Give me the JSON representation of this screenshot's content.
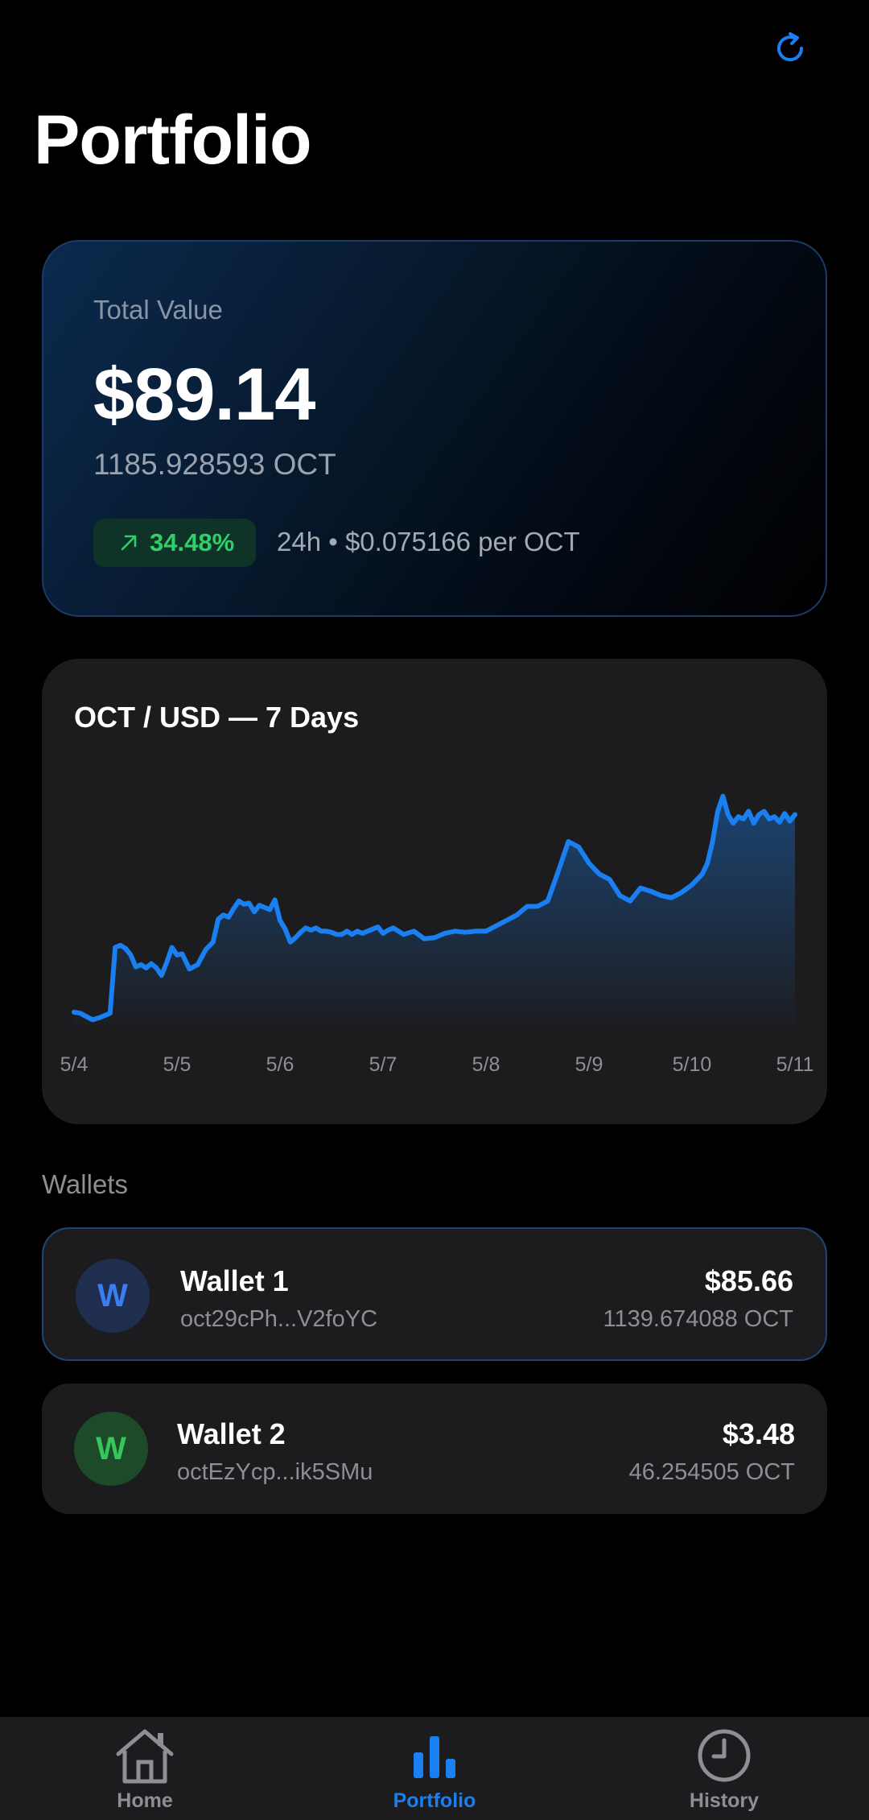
{
  "header": {
    "title": "Portfolio"
  },
  "total": {
    "label": "Total Value",
    "value": "$89.14",
    "oct": "1185.928593 OCT",
    "change_pct": "34.48%",
    "price_info": "24h • $0.075166 per OCT"
  },
  "colors": {
    "accent": "#1a7ff0",
    "positive": "#2fd06a",
    "card": "#1c1c1e"
  },
  "chart_data": {
    "type": "area",
    "title": "OCT / USD — 7 Days",
    "categories": [
      "5/4",
      "5/5",
      "5/6",
      "5/7",
      "5/8",
      "5/9",
      "5/10",
      "5/11"
    ],
    "x": [
      0,
      0.06,
      0.12,
      0.18,
      0.25,
      0.3,
      0.35,
      0.4,
      0.45,
      0.5,
      0.55,
      0.6,
      0.65,
      0.7,
      0.75,
      0.8,
      0.85,
      0.9,
      0.95,
      1.0,
      1.05,
      1.12,
      1.2,
      1.28,
      1.35,
      1.4,
      1.45,
      1.5,
      1.55,
      1.6,
      1.65,
      1.7,
      1.75,
      1.8,
      1.85,
      1.9,
      1.95,
      2.0,
      2.05,
      2.1,
      2.15,
      2.2,
      2.25,
      2.3,
      2.35,
      2.4,
      2.45,
      2.5,
      2.55,
      2.6,
      2.65,
      2.7,
      2.75,
      2.8,
      2.85,
      2.9,
      2.95,
      3.0,
      3.05,
      3.1,
      3.15,
      3.2,
      3.3,
      3.4,
      3.5,
      3.6,
      3.7,
      3.8,
      3.9,
      4.0,
      4.1,
      4.2,
      4.3,
      4.4,
      4.5,
      4.6,
      4.7,
      4.8,
      4.9,
      5.0,
      5.1,
      5.2,
      5.3,
      5.4,
      5.5,
      5.6,
      5.7,
      5.8,
      5.9,
      6.0,
      6.05,
      6.1,
      6.15,
      6.2,
      6.25,
      6.3,
      6.35,
      6.4,
      6.45,
      6.5,
      6.55,
      6.6,
      6.65,
      6.7,
      6.75,
      6.8,
      6.85,
      6.9,
      6.95,
      7.0
    ],
    "values": [
      0.0552,
      0.0551,
      0.0548,
      0.0545,
      0.0547,
      0.0549,
      0.0551,
      0.0612,
      0.0614,
      0.0611,
      0.0605,
      0.0594,
      0.0596,
      0.0593,
      0.0597,
      0.0593,
      0.0586,
      0.0598,
      0.0612,
      0.0605,
      0.0606,
      0.0592,
      0.0596,
      0.061,
      0.0617,
      0.0638,
      0.0642,
      0.064,
      0.0648,
      0.0655,
      0.0652,
      0.0653,
      0.0645,
      0.0651,
      0.0649,
      0.0647,
      0.0656,
      0.0637,
      0.0629,
      0.0617,
      0.0621,
      0.0626,
      0.063,
      0.0628,
      0.063,
      0.0627,
      0.0627,
      0.0626,
      0.0624,
      0.0624,
      0.0627,
      0.0624,
      0.0627,
      0.0625,
      0.0627,
      0.0629,
      0.0631,
      0.0625,
      0.0628,
      0.063,
      0.0627,
      0.0624,
      0.0627,
      0.062,
      0.0621,
      0.0625,
      0.0627,
      0.0626,
      0.0627,
      0.0627,
      0.0632,
      0.0637,
      0.0642,
      0.065,
      0.065,
      0.0655,
      0.0682,
      0.071,
      0.0705,
      0.069,
      0.068,
      0.0675,
      0.066,
      0.0655,
      0.0667,
      0.0664,
      0.066,
      0.0658,
      0.0663,
      0.067,
      0.0675,
      0.068,
      0.069,
      0.071,
      0.0738,
      0.0752,
      0.0735,
      0.0727,
      0.0733,
      0.0731,
      0.0738,
      0.0727,
      0.0735,
      0.0738,
      0.0731,
      0.0733,
      0.0728,
      0.0736,
      0.0729,
      0.0735
    ],
    "ylim": [
      0.054,
      0.076
    ],
    "xlim": [
      0,
      7
    ],
    "grid": false,
    "legend": "none"
  },
  "wallets_section": {
    "label": "Wallets"
  },
  "wallets": [
    {
      "initial": "W",
      "name": "Wallet 1",
      "address": "oct29cPh...V2foYC",
      "usd": "$85.66",
      "oct": "1139.674088 OCT"
    },
    {
      "initial": "W",
      "name": "Wallet 2",
      "address": "octEzYcp...ik5SMu",
      "usd": "$3.48",
      "oct": "46.254505 OCT"
    }
  ],
  "tabs": [
    {
      "label": "Home",
      "icon": "home-icon"
    },
    {
      "label": "Portfolio",
      "icon": "bar-chart-icon"
    },
    {
      "label": "History",
      "icon": "clock-icon"
    }
  ]
}
